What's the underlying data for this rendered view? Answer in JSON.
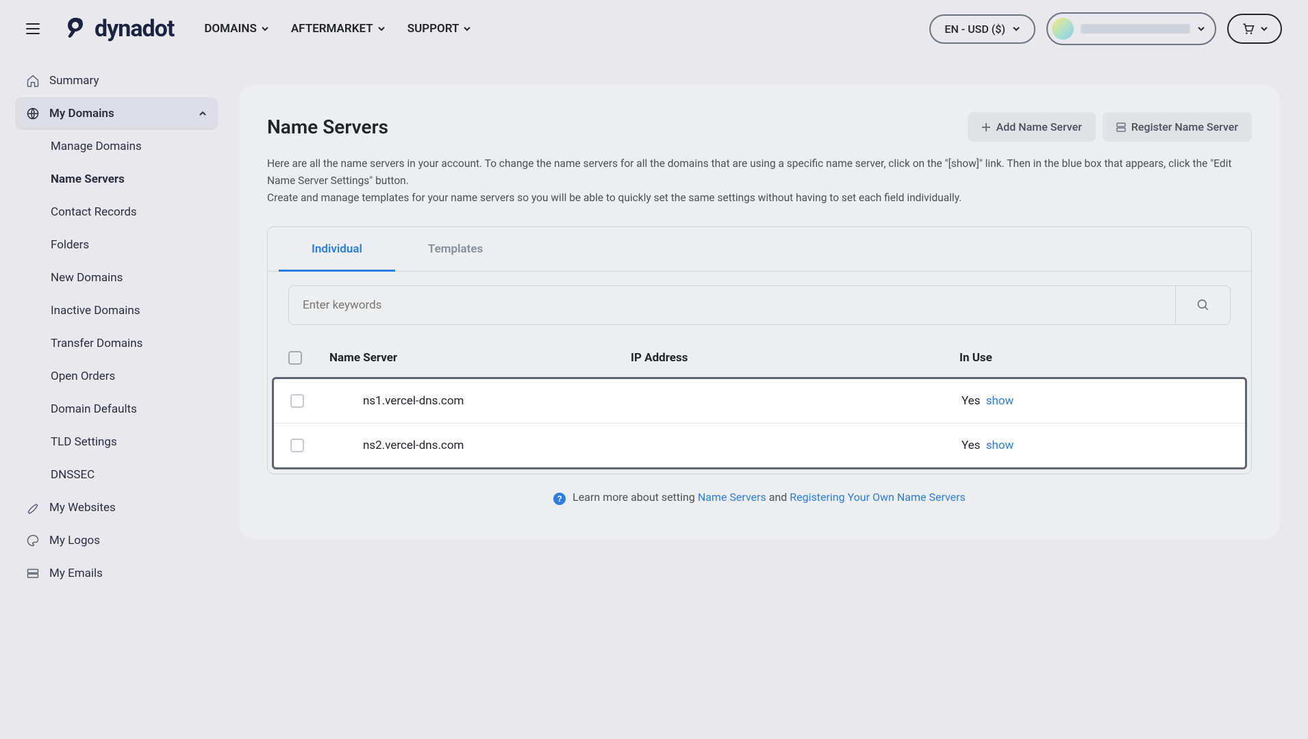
{
  "header": {
    "brand": "dynadot",
    "nav": [
      "DOMAINS",
      "AFTERMARKET",
      "SUPPORT"
    ],
    "locale": "EN - USD ($)"
  },
  "sidebar": {
    "summary": "Summary",
    "my_domains": "My Domains",
    "sub": [
      "Manage Domains",
      "Name Servers",
      "Contact Records",
      "Folders",
      "New Domains",
      "Inactive Domains",
      "Transfer Domains",
      "Open Orders",
      "Domain Defaults",
      "TLD Settings",
      "DNSSEC"
    ],
    "my_websites": "My Websites",
    "my_logos": "My Logos",
    "my_emails": "My Emails"
  },
  "page": {
    "title": "Name Servers",
    "add_btn": "Add Name Server",
    "register_btn": "Register Name Server",
    "desc_line1": "Here are all the name servers in your account. To change the name servers for all the domains that are using a specific name server, click on the \"[show]\" link. Then in the blue box that appears, click the \"Edit Name Server Settings\" button.",
    "desc_line2": "Create and manage templates for your name servers so you will be able to quickly set the same settings without having to set each field individually.",
    "tabs": {
      "individual": "Individual",
      "templates": "Templates"
    },
    "search_placeholder": "Enter keywords",
    "columns": {
      "name": "Name Server",
      "ip": "IP Address",
      "use": "In Use"
    },
    "rows": [
      {
        "name": "ns1.vercel-dns.com",
        "ip": "",
        "in_use": "Yes",
        "show": "show"
      },
      {
        "name": "ns2.vercel-dns.com",
        "ip": "",
        "in_use": "Yes",
        "show": "show"
      }
    ],
    "learn_prefix": "Learn more about setting ",
    "learn_link1": "Name Servers",
    "learn_and": " and ",
    "learn_link2": "Registering Your Own Name Servers"
  }
}
